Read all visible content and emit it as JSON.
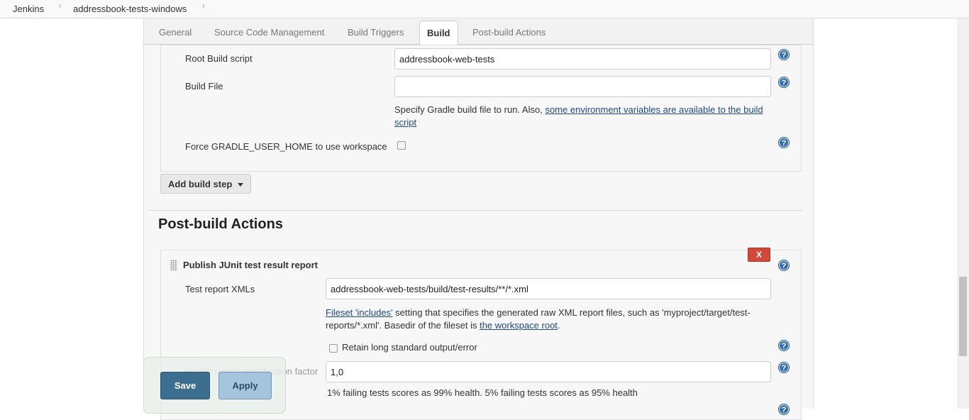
{
  "breadcrumb": {
    "root": "Jenkins",
    "job": "addressbook-tests-windows"
  },
  "tabs": [
    "General",
    "Source Code Management",
    "Build Triggers",
    "Build",
    "Post-build Actions"
  ],
  "build": {
    "root_build_script_label": "Root Build script",
    "root_build_script_value": "addressbook-web-tests",
    "build_file_label": "Build File",
    "build_file_value": "",
    "build_file_help_prefix": "Specify Gradle build file to run. Also, ",
    "build_file_help_link": "some environment variables are available to the build script",
    "force_gradle_label": "Force GRADLE_USER_HOME to use workspace",
    "force_gradle_checked": false,
    "add_build_step": "Add build step"
  },
  "post_build": {
    "title": "Post-build Actions",
    "delete_label": "X",
    "junit_title": "Publish JUnit test result report",
    "test_report_label": "Test report XMLs",
    "test_report_value": "addressbook-web-tests/build/test-results/**/*.xml",
    "fileset_link": "Fileset 'includes'",
    "fileset_text": " setting that specifies the generated raw XML report files, such as 'myproject/target/test-reports/*.xml'. Basedir of the fileset is ",
    "workspace_link": "the workspace root",
    "fileset_end": ".",
    "retain_label": "Retain long standard output/error",
    "retain_checked": false,
    "health_label": "Health report amplification factor",
    "health_value": "1,0",
    "health_help": "1% failing tests scores as 99% health. 5% failing tests scores as 95% health"
  },
  "buttons": {
    "save": "Save",
    "apply": "Apply"
  },
  "icons": {
    "help": "?",
    "breadcrumb_sep": "›"
  }
}
